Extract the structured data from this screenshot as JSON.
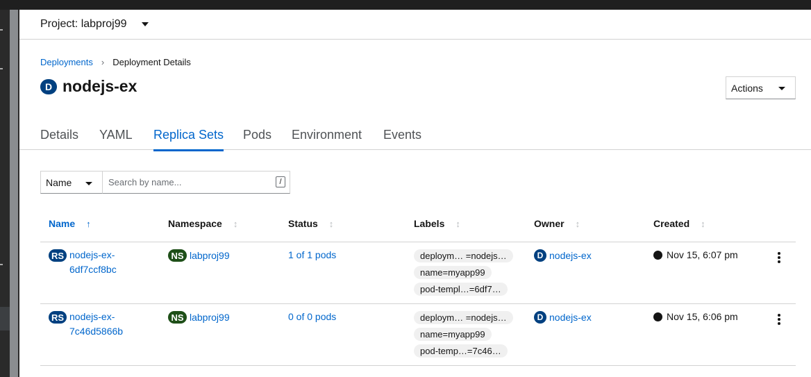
{
  "project": {
    "label": "Project: labproj99"
  },
  "breadcrumb": {
    "parent": "Deployments",
    "current": "Deployment Details"
  },
  "resource": {
    "badge": "D",
    "name": "nodejs-ex"
  },
  "actions": {
    "label": "Actions"
  },
  "tabs": [
    "Details",
    "YAML",
    "Replica Sets",
    "Pods",
    "Environment",
    "Events"
  ],
  "active_tab": "Replica Sets",
  "filter": {
    "type": "Name",
    "placeholder": "Search by name...",
    "shortcut": "/"
  },
  "columns": [
    "Name",
    "Namespace",
    "Status",
    "Labels",
    "Owner",
    "Created"
  ],
  "rows": [
    {
      "badge": "RS",
      "name": "nodejs-ex-6df7ccf8bc",
      "ns_badge": "NS",
      "namespace": "labproj99",
      "status": "1 of 1 pods",
      "labels": [
        "deploym… =nodejs…",
        "name=myapp99",
        "pod-templ…=6df7…"
      ],
      "owner_badge": "D",
      "owner": "nodejs-ex",
      "created": "Nov 15, 6:07 pm"
    },
    {
      "badge": "RS",
      "name": "nodejs-ex-7c46d5866b",
      "ns_badge": "NS",
      "namespace": "labproj99",
      "status": "0 of 0 pods",
      "labels": [
        "deploym… =nodejs…",
        "name=myapp99",
        "pod-temp…=7c46…"
      ],
      "owner_badge": "D",
      "owner": "nodejs-ex",
      "created": "Nov 15, 6:06 pm"
    }
  ],
  "colors": {
    "link": "#0066cc",
    "resource_badge": "#004080",
    "namespace_badge": "#1e4f18"
  },
  "icons": {
    "project_dropdown": "caret-down-icon",
    "sort": "sort-icon",
    "created": "globe-icon",
    "row_menu": "kebab-icon"
  }
}
